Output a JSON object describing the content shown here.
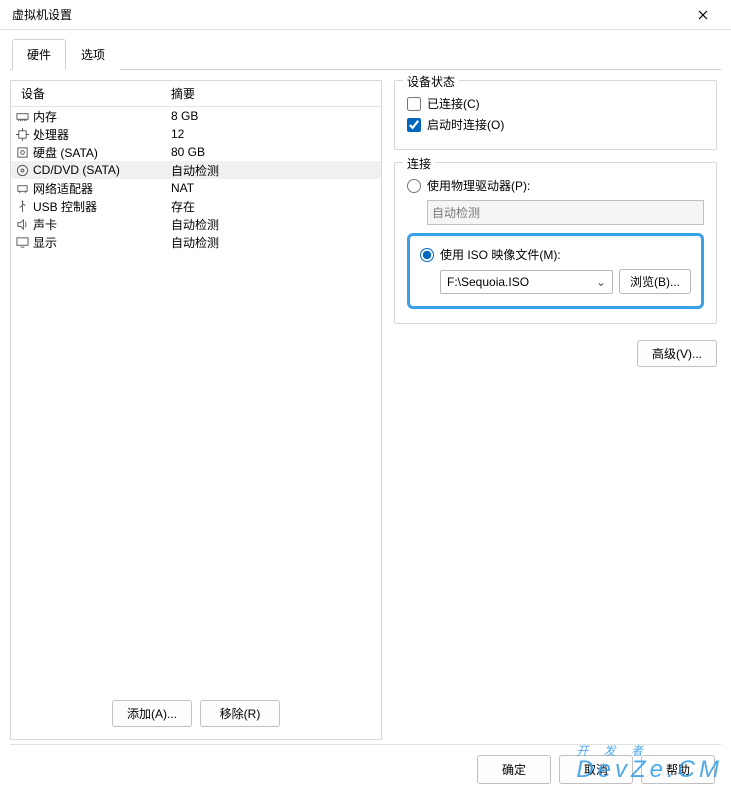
{
  "window": {
    "title": "虚拟机设置"
  },
  "tabs": [
    {
      "label": "硬件",
      "active": true
    },
    {
      "label": "选项",
      "active": false
    }
  ],
  "device_table": {
    "headers": {
      "device": "设备",
      "summary": "摘要"
    },
    "rows": [
      {
        "icon": "memory-icon",
        "name": "内存",
        "summary": "8 GB",
        "selected": false
      },
      {
        "icon": "cpu-icon",
        "name": "处理器",
        "summary": "12",
        "selected": false
      },
      {
        "icon": "disk-icon",
        "name": "硬盘 (SATA)",
        "summary": "80 GB",
        "selected": false
      },
      {
        "icon": "cd-icon",
        "name": "CD/DVD (SATA)",
        "summary": "自动检测",
        "selected": true
      },
      {
        "icon": "network-icon",
        "name": "网络适配器",
        "summary": "NAT",
        "selected": false
      },
      {
        "icon": "usb-icon",
        "name": "USB 控制器",
        "summary": "存在",
        "selected": false
      },
      {
        "icon": "sound-icon",
        "name": "声卡",
        "summary": "自动检测",
        "selected": false
      },
      {
        "icon": "display-icon",
        "name": "显示",
        "summary": "自动检测",
        "selected": false
      }
    ]
  },
  "left_buttons": {
    "add": "添加(A)...",
    "remove": "移除(R)"
  },
  "device_status": {
    "title": "设备状态",
    "connected": {
      "label": "已连接(C)",
      "checked": false
    },
    "connect_on": {
      "label": "启动时连接(O)",
      "checked": true
    }
  },
  "connection": {
    "title": "连接",
    "physical": {
      "label": "使用物理驱动器(P):",
      "selected": false,
      "drive": "自动检测"
    },
    "iso": {
      "label": "使用 ISO 映像文件(M):",
      "selected": true,
      "file": "F:\\Sequoia.ISO",
      "browse": "浏览(B)..."
    }
  },
  "advanced_button": "高级(V)...",
  "footer": {
    "ok": "确定",
    "cancel": "取消",
    "help": "帮助"
  },
  "watermark": {
    "line1": "开 发 者",
    "line2": "DevZe.CM"
  }
}
